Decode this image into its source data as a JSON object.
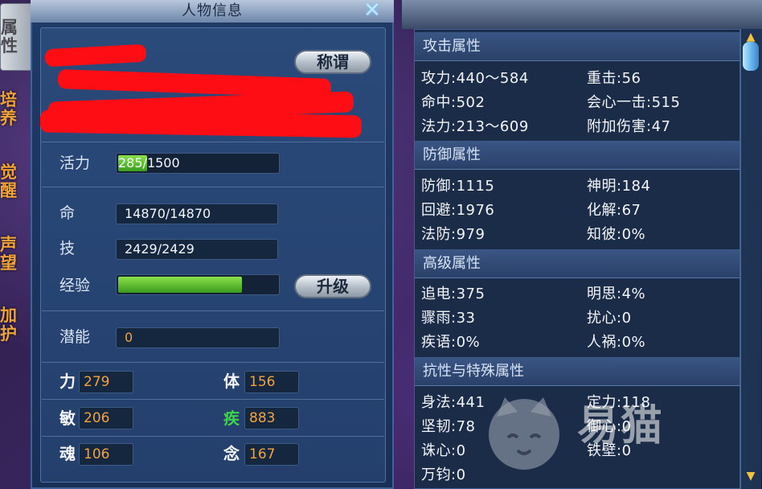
{
  "window": {
    "title": "人物信息",
    "close_icon": "close-icon"
  },
  "tabs": [
    {
      "label": "属性",
      "active": true
    },
    {
      "label": "培养",
      "active": false
    },
    {
      "label": "觉醒",
      "active": false
    },
    {
      "label": "声望",
      "active": false
    },
    {
      "label": "加护",
      "active": false
    }
  ],
  "character": {
    "title_button": "称谓",
    "vitality_label": "活力",
    "vitality_value": "285/",
    "vitality_max": "1500",
    "hp_label": "命",
    "hp_value": "14870/14870",
    "skill_label": "技",
    "skill_value": "2429/2429",
    "exp_label": "经验",
    "exp_progress": 0.77,
    "upgrade_button": "升级",
    "potential_label": "潜能",
    "potential_value": "0",
    "stats": {
      "str_label": "力",
      "str_value": "279",
      "con_label": "体",
      "con_value": "156",
      "agi_label": "敏",
      "agi_value": "206",
      "spd_label": "疾",
      "spd_value": "883",
      "soul_label": "魂",
      "soul_value": "106",
      "mind_label": "念",
      "mind_value": "167"
    }
  },
  "attributes": {
    "attack": {
      "header": "攻击属性",
      "items": [
        "攻力:440～584",
        "重击:56",
        "命中:502",
        "会心一击:515",
        "法力:213～609",
        "附加伤害:47"
      ]
    },
    "defense": {
      "header": "防御属性",
      "items": [
        "防御:1115",
        "神明:184",
        "回避:1976",
        "化解:67",
        "法防:979",
        "知彼:0%"
      ]
    },
    "advanced": {
      "header": "高级属性",
      "items": [
        "追电:375",
        "明思:4%",
        "骤雨:33",
        "扰心:0",
        "疾语:0%",
        "人祸:0%"
      ]
    },
    "resist": {
      "header": "抗性与特殊属性",
      "items": [
        "身法:441",
        "定力:118",
        "坚韧:78",
        "御心:0",
        "诛心:0",
        "铁壁:0",
        "万钧:0"
      ]
    }
  },
  "watermark": "易猫",
  "colors": {
    "accent_orange": "#f2a33c",
    "green": "#3fd34a",
    "panel_blue": "#243f6c"
  }
}
